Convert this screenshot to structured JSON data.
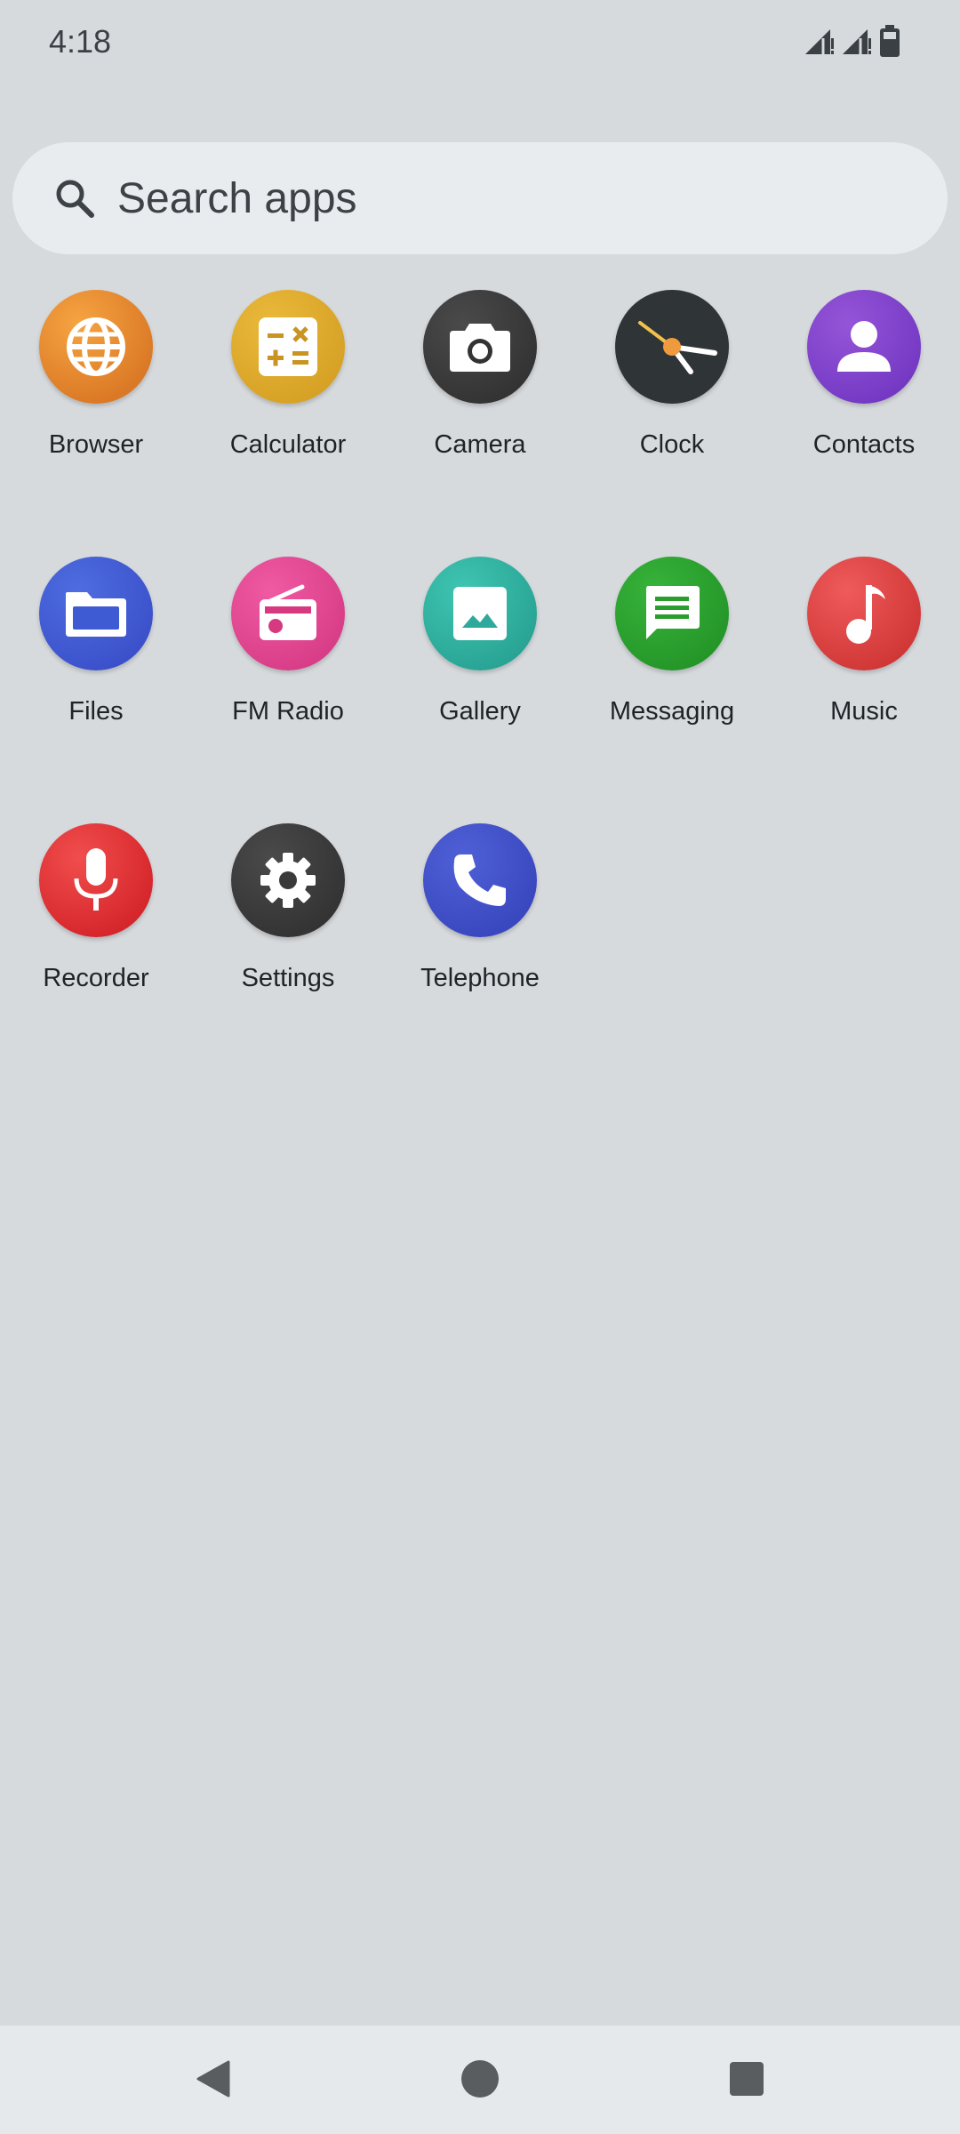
{
  "status_bar": {
    "time": "4:18",
    "icons": [
      "signal-icon",
      "signal-icon",
      "battery-icon"
    ]
  },
  "search": {
    "placeholder": "Search apps",
    "icon": "search-icon"
  },
  "apps": [
    {
      "label": "Browser",
      "icon": "globe-icon",
      "color": "#e07d25"
    },
    {
      "label": "Calculator",
      "icon": "calculator-icon",
      "color": "#d9a52a"
    },
    {
      "label": "Camera",
      "icon": "camera-icon",
      "color": "#3a3a3a"
    },
    {
      "label": "Clock",
      "icon": "clock-icon",
      "color": "#2f3437"
    },
    {
      "label": "Contacts",
      "icon": "person-icon",
      "color": "#7b3fc8"
    },
    {
      "label": "Files",
      "icon": "folder-icon",
      "color": "#3f5bd3"
    },
    {
      "label": "FM Radio",
      "icon": "radio-icon",
      "color": "#e2428f"
    },
    {
      "label": "Gallery",
      "icon": "image-icon",
      "color": "#2eaa9c"
    },
    {
      "label": "Messaging",
      "icon": "message-icon",
      "color": "#2a9e2d"
    },
    {
      "label": "Music",
      "icon": "music-note-icon",
      "color": "#dc3a3a"
    },
    {
      "label": "Recorder",
      "icon": "microphone-icon",
      "color": "#e0252b"
    },
    {
      "label": "Settings",
      "icon": "gear-icon",
      "color": "#3a3a3a"
    },
    {
      "label": "Telephone",
      "icon": "phone-icon",
      "color": "#3f4fc8"
    }
  ],
  "nav": {
    "back_icon": "back-triangle-icon",
    "home_icon": "home-circle-icon",
    "recents_icon": "recents-square-icon"
  }
}
